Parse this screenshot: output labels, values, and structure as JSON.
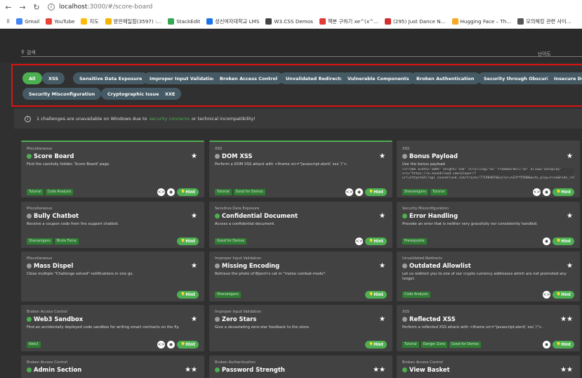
{
  "browser": {
    "url_host": "localhost",
    "url_rest": ":3000/#/score-board",
    "bookmarks": [
      "Gmail",
      "YouTube",
      "지도",
      "받은메일함(3597) :...",
      "StackEdit",
      "성신여자대학교 LMS",
      "W3.CSS Demos",
      "책분 구하기 xe^(x^...",
      "(295) Just Dance N...",
      "Hugging Face – Th...",
      "모의해킹 관련 사이..."
    ]
  },
  "search": {
    "label": "검색",
    "difficulty_label": "난이도"
  },
  "filters": [
    "All",
    "XSS",
    "Sensitive Data Exposure",
    "Improper Input Validation",
    "Broken Access Control",
    "Unvalidated Redirects",
    "Vulnerable Components",
    "Broken Authentication",
    "Security through Obscurity",
    "Insecure Deseria",
    "Security Misconfiguration",
    "Cryptographic Issues",
    "XXE"
  ],
  "notice": {
    "pre": "1 challenges are unavailable on Windows due to",
    "link": "security concerns",
    "post": "or technical incompatibility!"
  },
  "cards": [
    {
      "cat": "Miscellaneous",
      "title": "Score Board",
      "stars": "★",
      "desc": "Find the carefully hidden 'Score Board' page.",
      "tags": [
        "Tutorial",
        "Code Analysis"
      ],
      "code": true,
      "solved": true
    },
    {
      "cat": "XSS",
      "title": "DOM XSS",
      "stars": "★",
      "desc": "Perform a DOM XSS attack with <iframe src=\"javascript:alert(`xss`)\">.",
      "tags": [
        "Tutorial",
        "Good for Demos"
      ],
      "code": true,
      "solved": false
    },
    {
      "cat": "XSS",
      "title": "Bonus Payload",
      "stars": "★",
      "desc": "Use the bonus payload",
      "codebox": "<iframe width=\"100%\" height=\"166\" scrolling=\"no\" frameborder=\"no\" allow=\"autoplay\" src=\"https://w.soundcloud.com/player/?url=https%3A//api.soundcloud.com/tracks/771984076&color=%23ff5500&auto_play=true&hide_related=false&show_comments=true&show_user=true&show_reposts=false&show_teaser=true\"></iframe>",
      "tags": [
        "Shenanigans",
        "Tutorial"
      ],
      "code": true,
      "solved": false
    },
    {
      "cat": "Miscellaneous",
      "title": "Bully Chatbot",
      "stars": "★",
      "desc": "Receive a coupon code from the support chatbot.",
      "tags": [
        "Shenanigans",
        "Brute Force"
      ],
      "code": false,
      "solved": false
    },
    {
      "cat": "Sensitive Data Exposure",
      "title": "Confidential Document",
      "stars": "★",
      "desc": "Access a confidential document.",
      "tags": [
        "Good for Demos"
      ],
      "code": true,
      "solved": true
    },
    {
      "cat": "Security Misconfiguration",
      "title": "Error Handling",
      "stars": "★",
      "desc": "Provoke an error that is neither very gracefully nor consistently handled.",
      "tags": [
        "Prerequisite"
      ],
      "code": false,
      "solved": true
    },
    {
      "cat": "Miscellaneous",
      "title": "Mass Dispel",
      "stars": "★",
      "desc": "Close multiple \"Challenge solved\"-notifications in one go.",
      "tags": [],
      "code": false,
      "solved": false
    },
    {
      "cat": "Improper Input Validation",
      "title": "Missing Encoding",
      "stars": "★",
      "desc": "Retrieve the photo of Bjoern's cat in \"melee combat-mode\".",
      "tags": [
        "Shenanigans"
      ],
      "code": false,
      "solved": false
    },
    {
      "cat": "Unvalidated Redirects",
      "title": "Outdated Allowlist",
      "stars": "★",
      "desc": "Let us redirect you to one of our crypto currency addresses which are not promoted any longer.",
      "tags": [
        "Code Analysis"
      ],
      "code": true,
      "solved": false
    },
    {
      "cat": "Broken Access Control",
      "title": "Web3 Sandbox",
      "stars": "★",
      "desc": "Find an accidentally deployed code sandbox for writing smart contracts on the fly.",
      "tags": [
        "Web3"
      ],
      "code": true,
      "solved": true
    },
    {
      "cat": "Improper Input Validation",
      "title": "Zero Stars",
      "stars": "★",
      "desc": "Give a devastating zero-star feedback to the store.",
      "tags": [],
      "code": false,
      "solved": false
    },
    {
      "cat": "XSS",
      "title": "Reflected XSS",
      "stars": "★★",
      "desc": "Perform a reflected XSS attack with <iframe src=\"javascript:alert(`xss`)\">.",
      "tags": [
        "Tutorial",
        "Danger Zone",
        "Good for Demos"
      ],
      "code": false,
      "solved": false
    },
    {
      "cat": "Broken Access Control",
      "title": "Admin Section",
      "stars": "★★",
      "desc": "",
      "tags": [],
      "code": false,
      "solved": true
    },
    {
      "cat": "Broken Authentication",
      "title": "Password Strength",
      "stars": "★★",
      "desc": "",
      "tags": [],
      "code": false,
      "solved": true
    },
    {
      "cat": "Broken Access Control",
      "title": "View Basket",
      "stars": "★★",
      "desc": "",
      "tags": [],
      "code": false,
      "solved": true
    }
  ],
  "hint_label": "Hint",
  "colors": {
    "accent": "#4caf50",
    "chip": "#455a64",
    "card": "#424242",
    "highlight": "#e01010"
  }
}
